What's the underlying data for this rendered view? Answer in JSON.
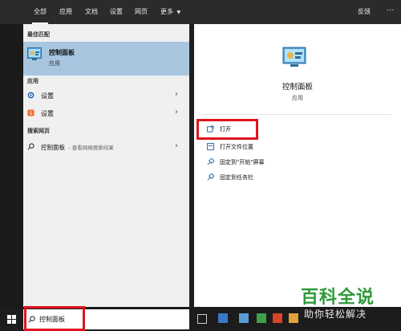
{
  "header": {
    "tabs": [
      "全部",
      "应用",
      "文档",
      "设置",
      "网页",
      "更多"
    ],
    "feedback": "反馈",
    "more_icon": "ellipsis-icon"
  },
  "left": {
    "best_match_title": "最佳匹配",
    "best_match": {
      "name": "控制面板",
      "type": "应用"
    },
    "apps_title": "应用",
    "apps": [
      {
        "label": "设置",
        "icon": "gear-icon"
      },
      {
        "label": "设置",
        "icon": "settings-app-icon"
      }
    ],
    "web_title": "搜索网页",
    "web": {
      "label": "控制面板",
      "hint": "- 查看网络搜索结果"
    }
  },
  "right": {
    "app_name": "控制面板",
    "app_type": "应用",
    "actions": [
      "打开",
      "打开文件位置",
      "固定到\"开始\"屏幕",
      "固定到任务栏"
    ]
  },
  "search": {
    "value": "控制面板"
  },
  "watermark": {
    "main": "百科全说",
    "sub": "助你轻松解决"
  },
  "colors": {
    "accent_red": "#e0141e",
    "selected_bg": "#a8c6e0"
  }
}
